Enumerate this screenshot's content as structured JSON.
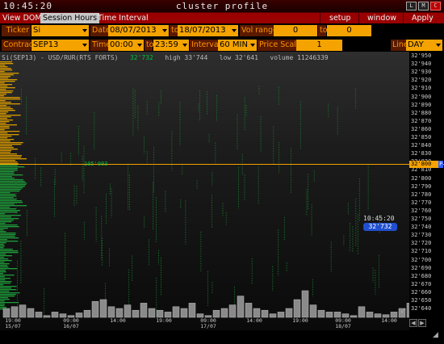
{
  "window": {
    "clock": "10:45:20",
    "title": "cluster profile",
    "buttons": [
      "L",
      "M",
      "C"
    ]
  },
  "menu": {
    "view_dom": "View DOM",
    "session_hours": "Session Hours",
    "time_interval": "Time Interval",
    "setup": "setup",
    "window": "window",
    "apply": "Apply"
  },
  "toolbar1": {
    "ticker_label": "Ticker",
    "ticker_value": "Si",
    "date_label": "Date",
    "date_from": "08/07/2013",
    "to1": "to",
    "date_to": "18/07/2013",
    "vol_range_label": "Vol range",
    "vol_from": "0",
    "to2": "to",
    "vol_to": "0"
  },
  "toolbar2": {
    "contract_label": "Contract",
    "contract_value": "SEP13",
    "time_label": "Time",
    "time_from": "00:00",
    "to": "to",
    "time_to": "23:59",
    "interval_label": "Interval",
    "interval_value": "60 MIN",
    "price_scale_label": "Price Scale",
    "price_scale_value": "1",
    "line_label": "Line",
    "line_value": "DAY"
  },
  "chart_info": {
    "instrument": "Si(SEP13) - USD/RUR(RTS FORTS)",
    "last": "32'732",
    "high": "high 33'744",
    "low": "low 32'641",
    "volume": "volume 11246339"
  },
  "level_label": "105'093",
  "current_price_tag": "32'800",
  "last_time": "10:45:20",
  "last_price": "32'732",
  "y_ticks": [
    "32'950",
    "32'940",
    "32'930",
    "32'920",
    "32'910",
    "32'900",
    "32'890",
    "32'880",
    "32'870",
    "32'860",
    "32'850",
    "32'840",
    "32'830",
    "32'820",
    "32'810",
    "32'800",
    "32'790",
    "32'780",
    "32'770",
    "32'760",
    "32'750",
    "32'740",
    "32'730",
    "32'720",
    "32'710",
    "32'700",
    "32'690",
    "32'680",
    "32'670",
    "32'660",
    "32'650",
    "32'640"
  ],
  "x_labels": [
    {
      "t": "19:00",
      "d": "15/07"
    },
    {
      "t": "09:00",
      "d": "16/07"
    },
    {
      "t": "14:00",
      "d": ""
    },
    {
      "t": "19:00",
      "d": ""
    },
    {
      "t": "09:00",
      "d": "17/07"
    },
    {
      "t": "14:00",
      "d": ""
    },
    {
      "t": "19:00",
      "d": ""
    },
    {
      "t": "09:00",
      "d": "18/07"
    },
    {
      "t": "14:00",
      "d": ""
    }
  ],
  "colors": {
    "accent": "#f5a300",
    "menu": "#9a0000",
    "up": "#00c040",
    "last": "#2050d0"
  }
}
